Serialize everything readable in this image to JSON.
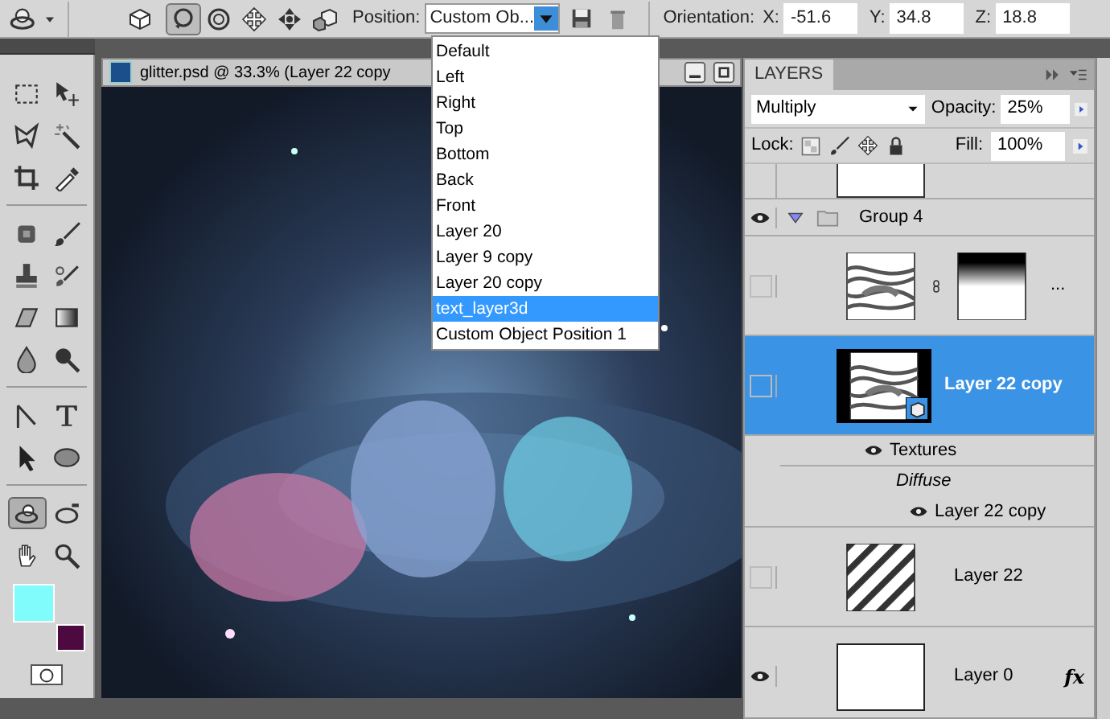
{
  "options_bar": {
    "modes": [
      {
        "kind": "rotate",
        "selected": true
      },
      {
        "kind": "roll",
        "selected": false
      },
      {
        "kind": "pan",
        "selected": false
      },
      {
        "kind": "slide",
        "selected": false
      },
      {
        "kind": "scale",
        "selected": false
      }
    ],
    "position_label": "Position:",
    "position_value": "Custom Ob...",
    "orientation_label": "Orientation:",
    "coords": [
      {
        "label": "X:",
        "value": "-51.6"
      },
      {
        "label": "Y:",
        "value": "34.8"
      },
      {
        "label": "Z:",
        "value": "18.8"
      }
    ]
  },
  "position_menu": [
    {
      "label": "Default",
      "selected": false
    },
    {
      "label": "Left",
      "selected": false
    },
    {
      "label": "Right",
      "selected": false
    },
    {
      "label": "Top",
      "selected": false
    },
    {
      "label": "Bottom",
      "selected": false
    },
    {
      "label": "Back",
      "selected": false
    },
    {
      "label": "Front",
      "selected": false
    },
    {
      "label": "Layer 20",
      "selected": false
    },
    {
      "label": "Layer 9 copy",
      "selected": false
    },
    {
      "label": "Layer 20 copy",
      "selected": false
    },
    {
      "label": "text_layer3d",
      "selected": true
    },
    {
      "label": "Custom Object Position 1",
      "selected": false
    }
  ],
  "tools": [
    {
      "kind": "marquee",
      "selected": false
    },
    {
      "kind": "move",
      "selected": false
    },
    {
      "kind": "lasso",
      "selected": false
    },
    {
      "kind": "wand",
      "selected": false
    },
    {
      "kind": "crop",
      "selected": false
    },
    {
      "kind": "eyedropper",
      "selected": false
    },
    {
      "kind": "healing",
      "selected": false
    },
    {
      "kind": "brush",
      "selected": false
    },
    {
      "kind": "stamp",
      "selected": false
    },
    {
      "kind": "history",
      "selected": false
    },
    {
      "kind": "eraser",
      "selected": false
    },
    {
      "kind": "gradient",
      "selected": false
    },
    {
      "kind": "blur",
      "selected": false
    },
    {
      "kind": "dodge",
      "selected": false
    },
    {
      "kind": "pen",
      "selected": false
    },
    {
      "kind": "type",
      "selected": false
    },
    {
      "kind": "select",
      "selected": false
    },
    {
      "kind": "ellipse",
      "selected": false
    },
    {
      "kind": "rotate3d",
      "selected": true
    },
    {
      "kind": "orbit",
      "selected": false
    },
    {
      "kind": "hand",
      "selected": false
    },
    {
      "kind": "zoom",
      "selected": false
    }
  ],
  "swatches": [
    {
      "kind": "foreground",
      "color": "#80fcfc"
    },
    {
      "kind": "background",
      "color": "#4c0a40"
    }
  ],
  "document": {
    "title": "glitter.psd @ 33.3% (Layer 22 copy"
  },
  "layers_panel": {
    "tab": "LAYERS",
    "blend_mode": "Multiply",
    "opacity_label": "Opacity:",
    "opacity": "25%",
    "lock_label": "Lock:",
    "fill_label": "Fill:",
    "fill": "100%",
    "layers": [
      {
        "kind": "group",
        "name": "Group 4",
        "visible": true,
        "expanded": true,
        "children": [
          {
            "kind": "masked",
            "name": "...",
            "visible": false,
            "selected": false
          },
          {
            "kind": "smart",
            "name": "Layer 22 copy",
            "visible": false,
            "selected": true,
            "textures_label": "Textures",
            "material": "Diffuse",
            "texture_layer": "Layer 22 copy"
          },
          {
            "kind": "pattern",
            "name": "Layer 22",
            "visible": false,
            "selected": false
          }
        ]
      },
      {
        "kind": "plain",
        "name": "Layer 0",
        "visible": true,
        "selected": false,
        "fx_label": "fx"
      }
    ]
  }
}
